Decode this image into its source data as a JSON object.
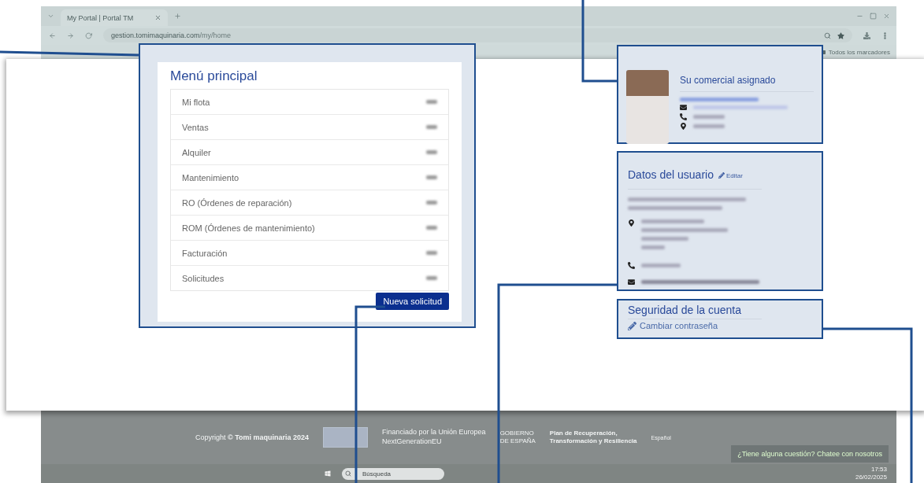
{
  "browser": {
    "tab_title": "My Portal | Portal TM",
    "url_host": "gestion.tomimaquinaria.com",
    "url_path": "/my/home",
    "bookmarks": "Todos los marcadores"
  },
  "menu": {
    "title": "Menú principal",
    "items": [
      {
        "label": "Mi flota"
      },
      {
        "label": "Ventas"
      },
      {
        "label": "Alquiler"
      },
      {
        "label": "Mantenimiento"
      },
      {
        "label": "RO (Órdenes de reparación)"
      },
      {
        "label": "ROM (Órdenes de mantenimiento)"
      },
      {
        "label": "Facturación"
      },
      {
        "label": "Solicitudes"
      }
    ],
    "button": "Nueva solicitud"
  },
  "commercial": {
    "title": "Su comercial asignado"
  },
  "user": {
    "title": "Datos del usuario",
    "edit": "Editar"
  },
  "security": {
    "title": "Seguridad de la cuenta",
    "link": "Cambiar contraseña"
  },
  "footer": {
    "copyright": "Copyright **© Tomi maquinaria 2024**",
    "eu_lines": [
      "Financiado por la Unión Europea",
      "NextGenerationEU"
    ],
    "gov_lines": [
      "GOBIERNO",
      "DE ESPAÑA"
    ],
    "plan_lines": [
      "Plan de Recuperación,",
      "Transformación y Resiliencia"
    ],
    "language": "Español",
    "chat": "¿Tiene alguna cuestión? Chatee con nosotros"
  },
  "taskbar": {
    "search_placeholder": "Búsqueda",
    "time": "17:53",
    "date": "26/02/2025"
  }
}
